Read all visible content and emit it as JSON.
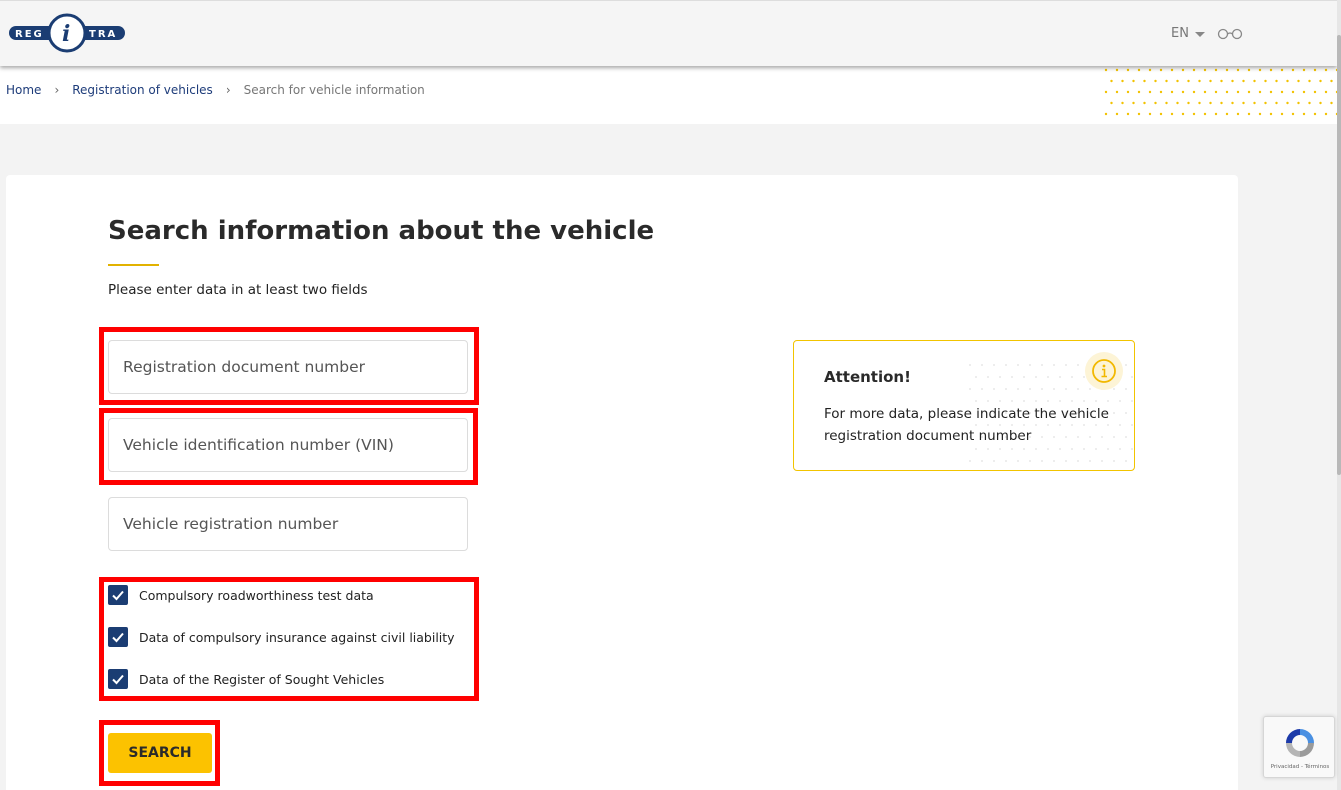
{
  "header": {
    "logo_text": "REG i TRA",
    "language": "EN"
  },
  "breadcrumb": [
    {
      "label": "Home"
    },
    {
      "label": "Registration of vehicles"
    },
    {
      "label": "Search for vehicle information"
    }
  ],
  "form": {
    "title": "Search information about the vehicle",
    "hint": "Please enter data in at least two fields",
    "fields": [
      {
        "placeholder": "Registration document number",
        "value": ""
      },
      {
        "placeholder": "Vehicle identification number (VIN)",
        "value": ""
      },
      {
        "placeholder": "Vehicle registration number",
        "value": ""
      }
    ],
    "checkboxes": [
      {
        "label": "Compulsory roadworthiness test data",
        "checked": true
      },
      {
        "label": "Data of compulsory insurance against civil liability",
        "checked": true
      },
      {
        "label": "Data of the Register of Sought Vehicles",
        "checked": true
      }
    ],
    "search_label": "SEARCH"
  },
  "attention": {
    "title": "Attention!",
    "text": "For more data, please indicate the vehicle registration document number"
  },
  "recaptcha": {
    "footer": "Privacidad - Términos"
  },
  "colors": {
    "brand_navy": "#1b3d73",
    "accent_yellow": "#fcc200",
    "highlight_red": "#ff0000"
  }
}
